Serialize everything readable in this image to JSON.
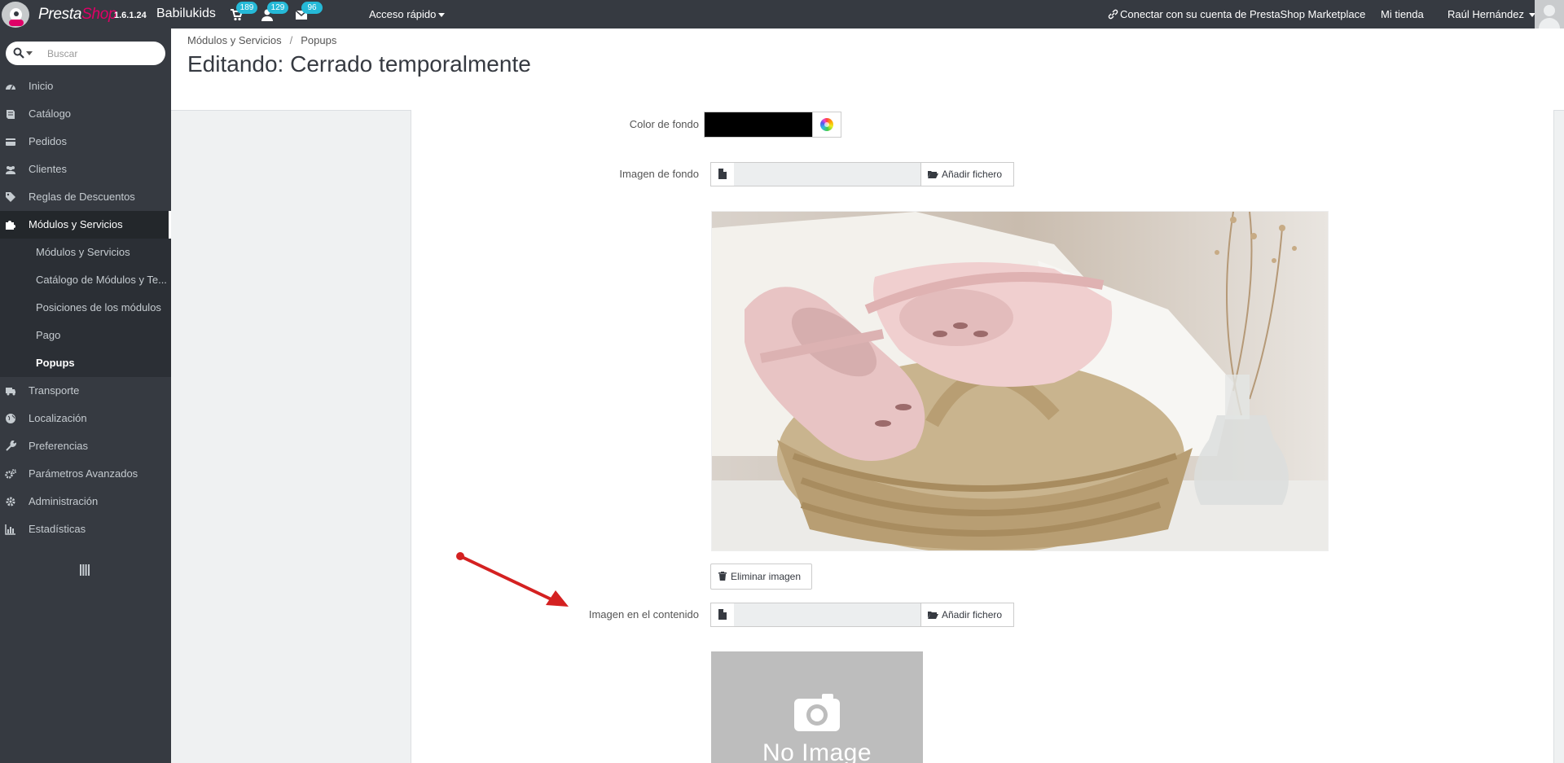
{
  "topbar": {
    "brand_presta": "Presta",
    "brand_shop": "Shop",
    "version": "1.6.1.24",
    "shop_name": "Babilukids",
    "notifications": [
      {
        "icon": "cart-icon",
        "count": "189"
      },
      {
        "icon": "user-icon",
        "count": "129"
      },
      {
        "icon": "envelope-icon",
        "count": "96"
      }
    ],
    "quick_access": "Acceso rápido",
    "connect": "Conectar con su cuenta de PrestaShop Marketplace",
    "my_shop": "Mi tienda",
    "user": "Raúl Hernández"
  },
  "sidebar": {
    "search_placeholder": "Buscar",
    "items": [
      {
        "label": "Inicio",
        "icon": "dashboard-icon"
      },
      {
        "label": "Catálogo",
        "icon": "book-icon"
      },
      {
        "label": "Pedidos",
        "icon": "credit-card-icon"
      },
      {
        "label": "Clientes",
        "icon": "users-icon"
      },
      {
        "label": "Reglas de Descuentos",
        "icon": "tags-icon"
      },
      {
        "label": "Módulos y Servicios",
        "icon": "puzzle-icon"
      },
      {
        "label": "Transporte",
        "icon": "truck-icon"
      },
      {
        "label": "Localización",
        "icon": "globe-icon"
      },
      {
        "label": "Preferencias",
        "icon": "wrench-icon"
      },
      {
        "label": "Parámetros Avanzados",
        "icon": "cogs-icon"
      },
      {
        "label": "Administración",
        "icon": "cog-icon"
      },
      {
        "label": "Estadísticas",
        "icon": "bar-chart-icon"
      }
    ],
    "subitems": [
      {
        "label": "Módulos y Servicios"
      },
      {
        "label": "Catálogo de Módulos y Te..."
      },
      {
        "label": "Posiciones de los módulos"
      },
      {
        "label": "Pago"
      },
      {
        "label": "Popups"
      }
    ]
  },
  "header": {
    "breadcrumb": [
      "Módulos y Servicios",
      "Popups"
    ],
    "title": "Editando: Cerrado temporalmente"
  },
  "form": {
    "bg_color_label": "Color de fondo",
    "bg_color_value": "#000000",
    "bg_image_label": "Imagen de fondo",
    "add_file": "Añadir fichero",
    "delete_image": "Eliminar imagen",
    "content_image_label": "Imagen en el contenido",
    "no_image": "No Image"
  },
  "colors": {
    "topbar": "#363a41",
    "accent_pink": "#df0067",
    "badge": "#25b9d7",
    "arrow": "#d42121"
  }
}
